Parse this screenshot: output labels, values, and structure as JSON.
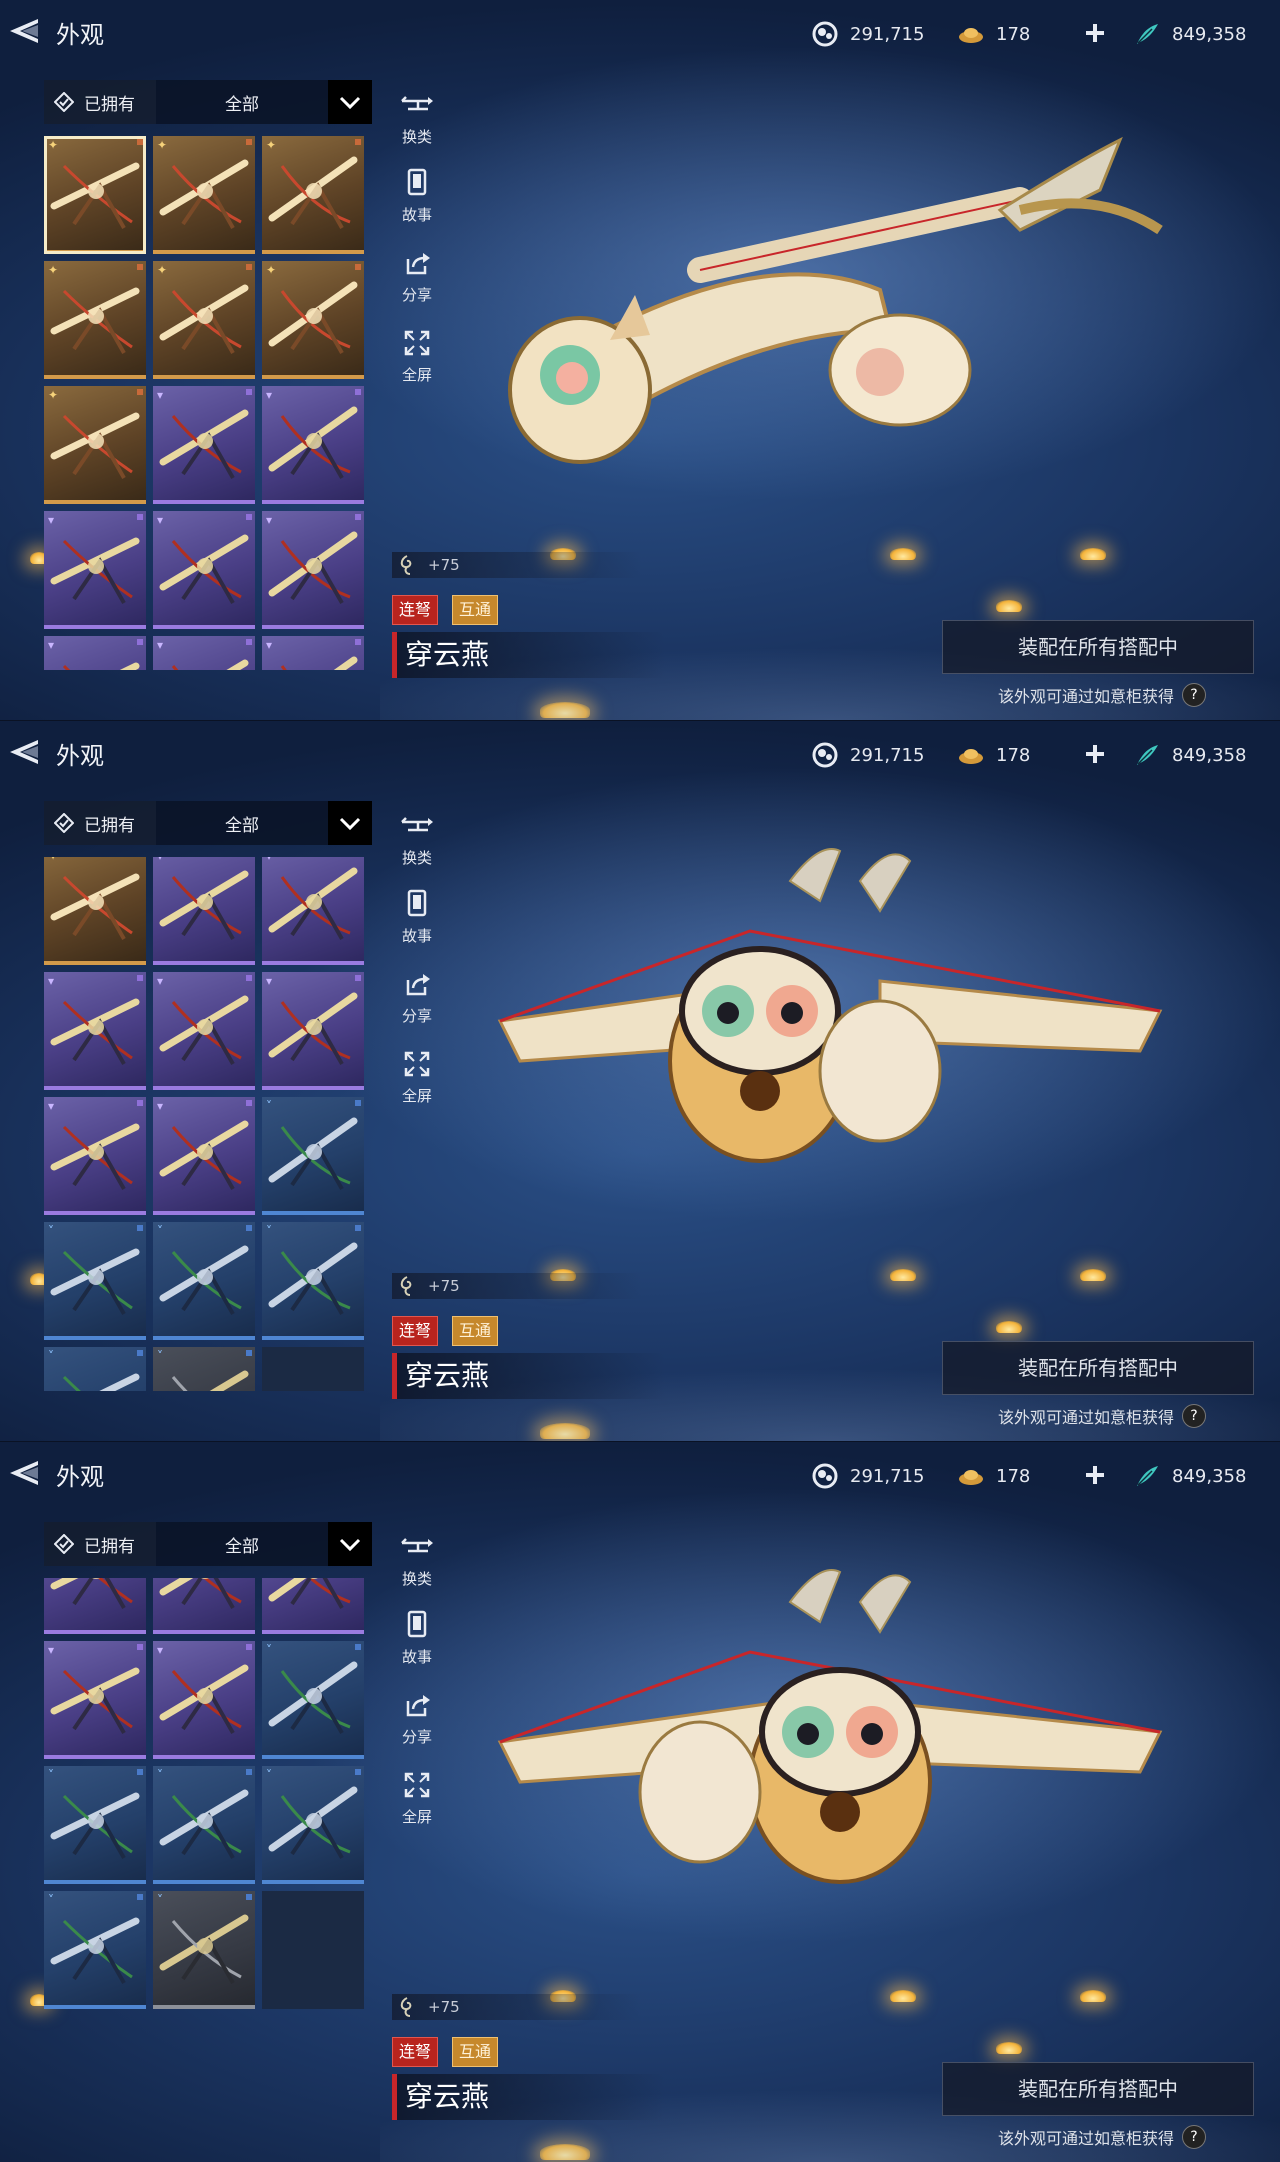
{
  "header": {
    "title": "外观",
    "currencies": [
      {
        "icon": "jade-currency-icon",
        "value": "291,715"
      },
      {
        "icon": "gold-ingot-icon",
        "value": "178"
      },
      {
        "icon": "feather-currency-icon",
        "value": "849,358"
      }
    ]
  },
  "filter": {
    "owned_label": "已拥有",
    "category": "全部"
  },
  "actions": [
    {
      "icon": "swap-type-icon",
      "label": "换类"
    },
    {
      "icon": "story-book-icon",
      "label": "故事"
    },
    {
      "icon": "share-icon",
      "label": "分享"
    },
    {
      "icon": "fullscreen-icon",
      "label": "全屏"
    }
  ],
  "item": {
    "bonus": "+75",
    "tags": [
      "连弩",
      "互通"
    ],
    "name": "穿云燕",
    "equip_label": "装配在所有搭配中",
    "obtain_hint": "该外观可通过如意柜获得",
    "help": "?"
  },
  "colors": {
    "selected_outline": "#f6ecc8",
    "tag_red": "#b8241e",
    "tag_gold": "#c6882c",
    "name_accent": "#c8262a"
  }
}
